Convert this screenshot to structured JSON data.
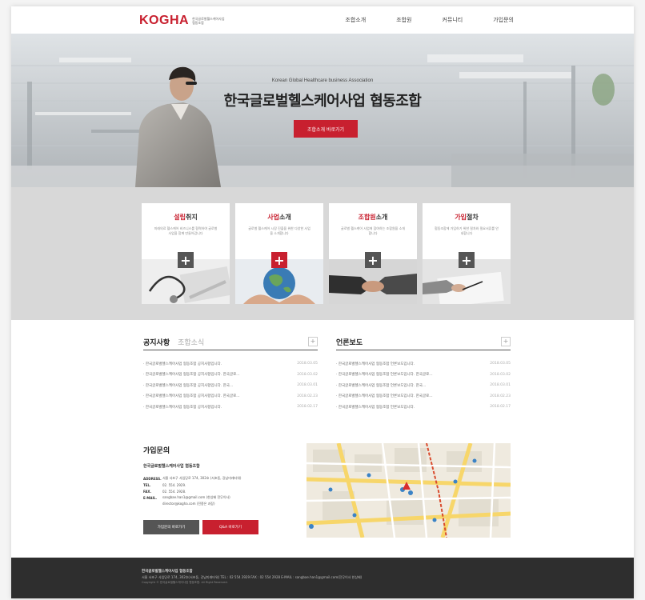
{
  "header": {
    "logo": "KOGHA",
    "logo_sub": "한국글로벌헬스케어사업협동조합",
    "nav": [
      "조합소개",
      "조합원",
      "커뮤니티",
      "가입문의"
    ]
  },
  "hero": {
    "subtitle": "Korean Global Healthcare business Association",
    "title": "한국글로벌헬스케어사업 협동조합",
    "button": "조합소개 바로가기"
  },
  "cards": [
    {
      "title_red": "설립",
      "title_rest": "취지",
      "desc": "미래의료 헬스케어 비즈니스를 협력하여 글로벌 사업을 함께 만들어갑니다",
      "plus": "+"
    },
    {
      "title_red": "사업",
      "title_rest": "소개",
      "desc": "글로벌 헬스케어 시장 진출을 위한 다양한 사업을 소개합니다",
      "plus": "+"
    },
    {
      "title_red": "조합원",
      "title_rest": "소개",
      "desc": "글로벌 헬스케어 사업에 참여하는 조합원을 소개합니다",
      "plus": "+"
    },
    {
      "title_red": "가입",
      "title_rest": "절차",
      "desc": "협동조합에 가입하기 위한 절차와 필요서류를 안내합니다",
      "plus": "+"
    }
  ],
  "notice": {
    "tab_active": "공지사항",
    "tab_inactive": "조합소식",
    "more": "+",
    "items": [
      {
        "text": "· 한국글로벌헬스케어사업 협동조합 공지사항입니다.",
        "date": "2018.03.05"
      },
      {
        "text": "· 한국글로벌헬스케어사업 협동조합 공지사항입니다. 한국글로...",
        "date": "2018.03.02"
      },
      {
        "text": "· 한국글로벌헬스케어사업 협동조합 공지사항입니다. 한국...",
        "date": "2018.03.01"
      },
      {
        "text": "· 한국글로벌헬스케어사업 협동조합 공지사항입니다. 한국글로...",
        "date": "2018.02.23"
      },
      {
        "text": "· 한국글로벌헬스케어사업 협동조합 공지사항입니다.",
        "date": "2018.02.17"
      }
    ]
  },
  "press": {
    "title": "언론보도",
    "more": "+",
    "items": [
      {
        "text": "· 한국글로벌헬스케어사업 협동조합 언론보도입니다.",
        "date": "2018.03.05"
      },
      {
        "text": "· 한국글로벌헬스케어사업 협동조합 언론보도입니다. 한국글로...",
        "date": "2018.03.02"
      },
      {
        "text": "· 한국글로벌헬스케어사업 협동조합 언론보도입니다. 한국...",
        "date": "2018.03.01"
      },
      {
        "text": "· 한국글로벌헬스케어사업 협동조합 언론보도입니다. 한국글로...",
        "date": "2018.02.23"
      },
      {
        "text": "· 한국글로벌헬스케어사업 협동조합 언론보도입니다.",
        "date": "2018.02.17"
      }
    ]
  },
  "contact": {
    "title": "가입문의",
    "org": "한국글로벌헬스케어사업 협동조합",
    "rows": [
      {
        "k": "ADDRESS.",
        "v": "서울 서초구 사임당로 174, 302호 (서초동, 강남미래타워)"
      },
      {
        "k": "TEL.",
        "v": "02. 554. 2929."
      },
      {
        "k": "FAX.",
        "v": "02. 554. 2928."
      },
      {
        "k": "E-MAIL.",
        "v": "sangbae.han1@gmail.com (한상배 전무이사)"
      },
      {
        "k": "",
        "v": "director@kogha.com (전종은 과장)"
      }
    ],
    "btn_join": "가입문의 바로가기",
    "btn_qa": "Q&A 바로가기"
  },
  "footer": {
    "line1": "한국글로벌헬스케어사업 협동조합",
    "line2": "서울 서초구 사임당로 174, 302호(서초동, 강남미래타워)   TEL : 02 554 2929   FAX : 02 554 2928   E-MAIL : sangbae.han1@gmail.com(전무이사 한상배)",
    "line3": "Copyright © 한국글로벌헬스케어사업 협동조합. All Right Reserved."
  },
  "colors": {
    "accent": "#c8202f",
    "footer_bg": "#2e2e2e",
    "band_bg": "#d8d8d8"
  }
}
